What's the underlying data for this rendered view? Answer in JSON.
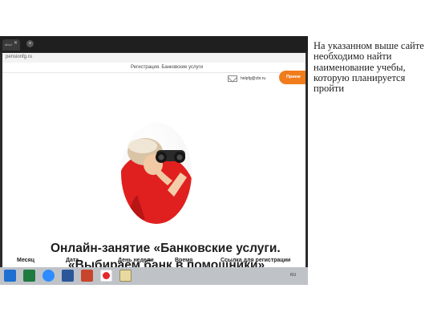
{
  "browser": {
    "tab_label": "abcd",
    "tab_close": "✕",
    "new_tab": "+",
    "url": "pensionfg.ru"
  },
  "page": {
    "title": "Регистрация. Банковские услуги",
    "email": "helpfg@cbr.ru",
    "cta_label": "Прием",
    "course_title_line1": "Онлайн-занятие «Банковские услуги.",
    "course_title_line2": "«Выбираем банк в помощники»",
    "columns": [
      "Месяц",
      "Дата",
      "День недели",
      "Время",
      "Ссылка для регистрации"
    ]
  },
  "taskbar": {
    "apps": [
      "windows-start",
      "excel",
      "zoom",
      "word",
      "powerpoint",
      "yandex-browser",
      "files"
    ],
    "clock": "RU"
  },
  "note": {
    "text": "На указанном выше сайте необходимо найти наименование учебы, которую планируется пройти"
  },
  "colors": {
    "accent": "#f07c1c",
    "taskbar": "#bfc3c8"
  }
}
